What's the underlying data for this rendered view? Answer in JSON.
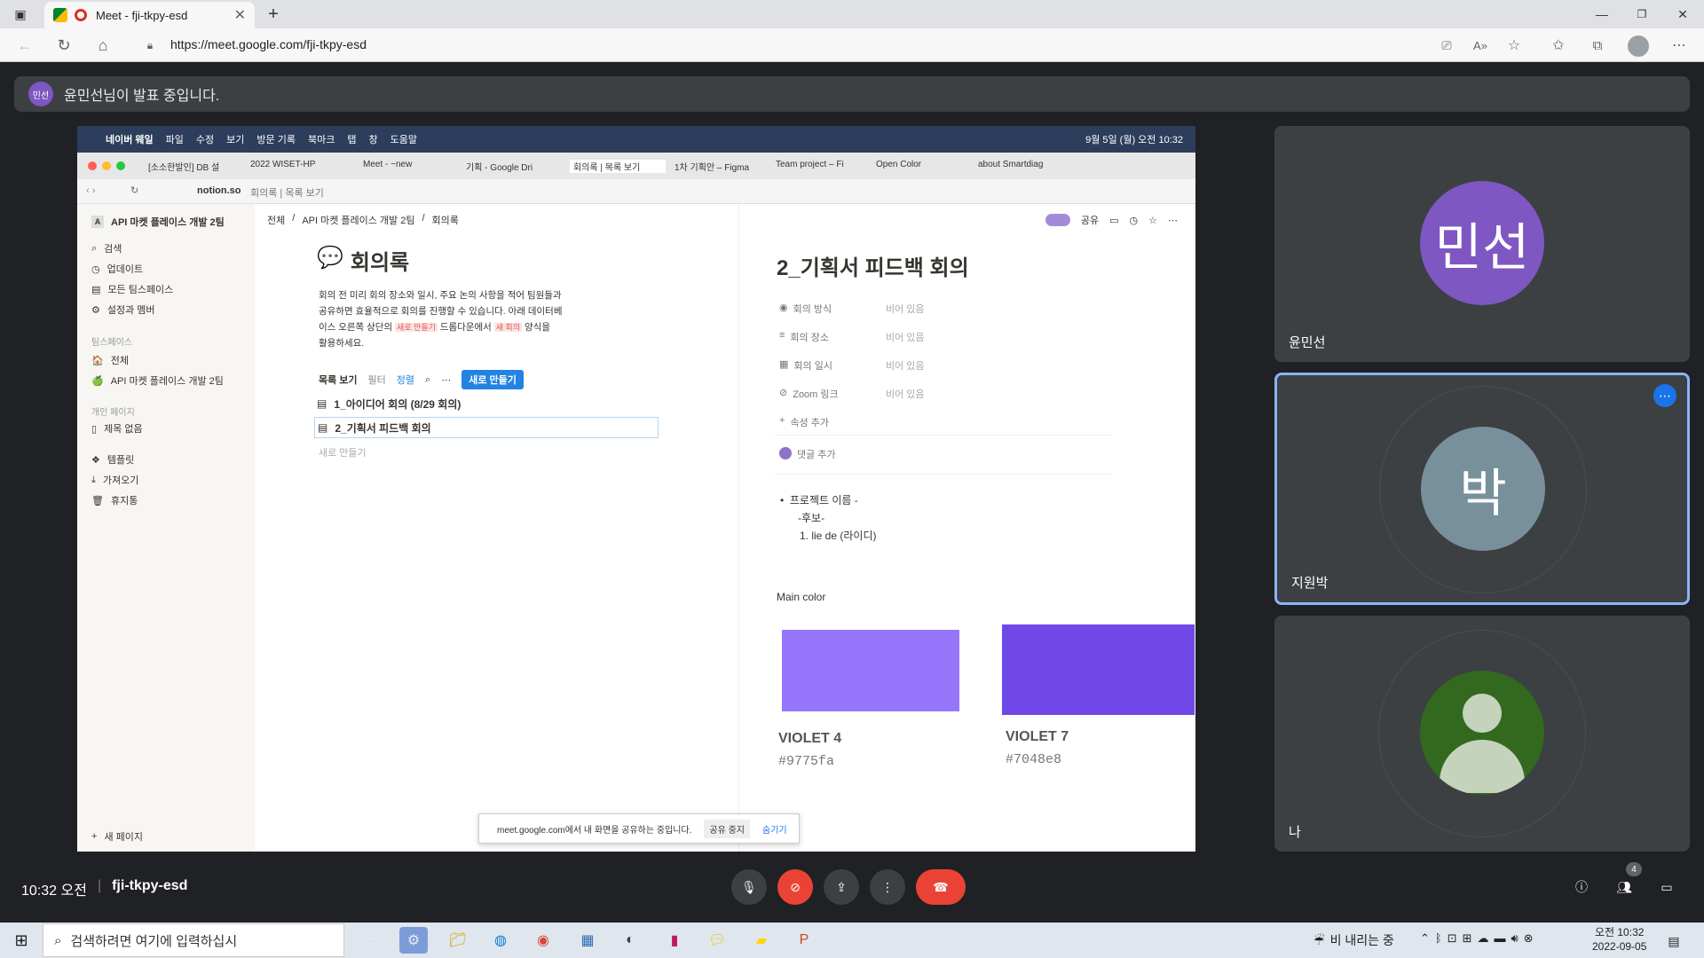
{
  "browser": {
    "tab_title": "Meet - fji-tkpy-esd",
    "url": "https://meet.google.com/fji-tkpy-esd"
  },
  "meet": {
    "presenter_avatar": "민선",
    "presenting_banner": "윤민선님이 발표 중입니다.",
    "time": "10:32 오전",
    "meeting_code": "fji-tkpy-esd",
    "participant_count": "4",
    "participants": [
      {
        "name": "윤민선",
        "avatar_text": "민선",
        "color": "#7e57c2"
      },
      {
        "name": "지원박",
        "avatar_text": "박",
        "color": "#78909c"
      },
      {
        "name": "나",
        "avatar_text": "",
        "color": "#33691e"
      }
    ]
  },
  "shared": {
    "mac_menu": [
      "네이버 웨일",
      "파일",
      "수정",
      "보기",
      "방문 기록",
      "북마크",
      "탭",
      "창",
      "도움말"
    ],
    "mac_clock": "9월 5일 (월) 오전 10:32",
    "tabs": [
      "[소소한발인] DB 설",
      "2022 WISET-HP",
      "Meet - ~new",
      "기획 - Google Dri",
      "회의록 | 목록 보기",
      "1차 기획안 – Figma",
      "Team project – Fi",
      "Open Color",
      "about Smartdiag"
    ],
    "address_host": "notion.so",
    "address_path": "회의록 | 목록 보기",
    "breadcrumb": [
      "전체",
      "API 마켓 플레이스 개발 2팀",
      "회의록"
    ],
    "share_label": "공유",
    "sidebar": {
      "workspace": "API 마켓 플레이스 개발 2팀",
      "workspace_letter": "A",
      "top_items": [
        "검색",
        "업데이트",
        "모든 팀스페이스",
        "설정과 멤버"
      ],
      "teamspace_header": "팀스페이스",
      "teamspace_items": [
        "전체",
        "API 마켓 플레이스 개발 2팀"
      ],
      "personal_header": "개인 페이지",
      "personal_items": [
        "제목 없음"
      ],
      "bottom_items": [
        "템플릿",
        "가져오기",
        "휴지통"
      ],
      "new_page": "새 페이지"
    },
    "db": {
      "title": "회의록",
      "desc_line1": "회의 전 미리 회의 장소와 일시, 주요 논의 사항을 적어 팀원들과",
      "desc_line2": "공유하면 효율적으로 회의를 진행할 수 있습니다. 아래 데이터베",
      "desc_line3_a": "이스 오른쪽 상단의",
      "desc_chip1": "새로 만들기",
      "desc_line3_b": "드롭다운에서",
      "desc_chip2": "새 회의",
      "desc_line3_c": "양식을",
      "desc_line4": "활용하세요.",
      "view_label": "목록 보기",
      "filter_label": "필터",
      "sort_label": "정렬",
      "new_label": "새로 만들기",
      "rows": [
        "1_아이디어 회의 (8/29 회의)",
        "2_기획서 피드백 회의"
      ],
      "add_row": "새로 만들기"
    },
    "page": {
      "title": "2_기획서 피드백 회의",
      "props": [
        {
          "name": "회의 방식",
          "value": "비어 있음"
        },
        {
          "name": "회의 장소",
          "value": "비어 있음"
        },
        {
          "name": "회의 일시",
          "value": "비어 있음"
        },
        {
          "name": "Zoom 링크",
          "value": "비어 있음"
        }
      ],
      "add_prop": "속성 추가",
      "add_comment": "댓글 추가",
      "bullet1": "프로젝트 이름 -",
      "bullet2": "-후보-",
      "bullet3": "1. lie de (라이디)",
      "main_color": "Main color",
      "colors": [
        {
          "name": "VIOLET 4",
          "hex": "#9775fa"
        },
        {
          "name": "VIOLET 7",
          "hex": "#7048e8"
        }
      ]
    },
    "share_notice": "meet.google.com에서 내 화면을 공유하는 중입니다.",
    "stop_sharing": "공유 중지",
    "hide": "숨기기"
  },
  "taskbar": {
    "search_placeholder": "검색하려면 여기에 입력하십시",
    "weather": "비 내리는 중",
    "time": "오전 10:32",
    "date": "2022-09-05"
  }
}
